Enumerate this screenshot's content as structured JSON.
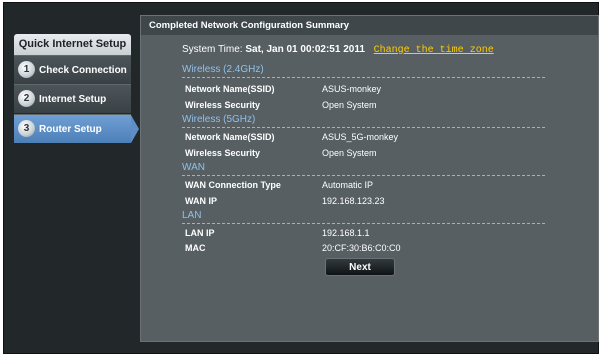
{
  "sidebar": {
    "title": "Quick Internet Setup",
    "items": [
      {
        "num": "1",
        "label": "Check Connection"
      },
      {
        "num": "2",
        "label": "Internet Setup"
      },
      {
        "num": "3",
        "label": "Router Setup"
      }
    ]
  },
  "panel": {
    "title": "Completed Network Configuration Summary",
    "system_time_label": "System Time:",
    "system_time_value": "Sat, Jan 01 00:02:51 2011",
    "change_tz_link": "Change the time zone",
    "sections": {
      "wireless24": {
        "title": "Wireless (2.4GHz)",
        "ssid_key": "Network Name(SSID)",
        "ssid_val": "ASUS-monkey",
        "sec_key": "Wireless Security",
        "sec_val": "Open System"
      },
      "wireless5": {
        "title": "Wireless (5GHz)",
        "ssid_key": "Network Name(SSID)",
        "ssid_val": "ASUS_5G-monkey",
        "sec_key": "Wireless Security",
        "sec_val": "Open System"
      },
      "wan": {
        "title": "WAN",
        "type_key": "WAN Connection Type",
        "type_val": "Automatic IP",
        "ip_key": "WAN IP",
        "ip_val": "192.168.123.23"
      },
      "lan": {
        "title": "LAN",
        "ip_key": "LAN IP",
        "ip_val": "192.168.1.1",
        "mac_key": "MAC",
        "mac_val": "20:CF:30:B6:C0:C0"
      }
    },
    "next_label": "Next"
  },
  "colors": {
    "background": "#22272a",
    "panel": "#575f63",
    "section_title": "#8fc0ea",
    "link": "#ffcc00",
    "active_item": "#5d8ec6"
  }
}
